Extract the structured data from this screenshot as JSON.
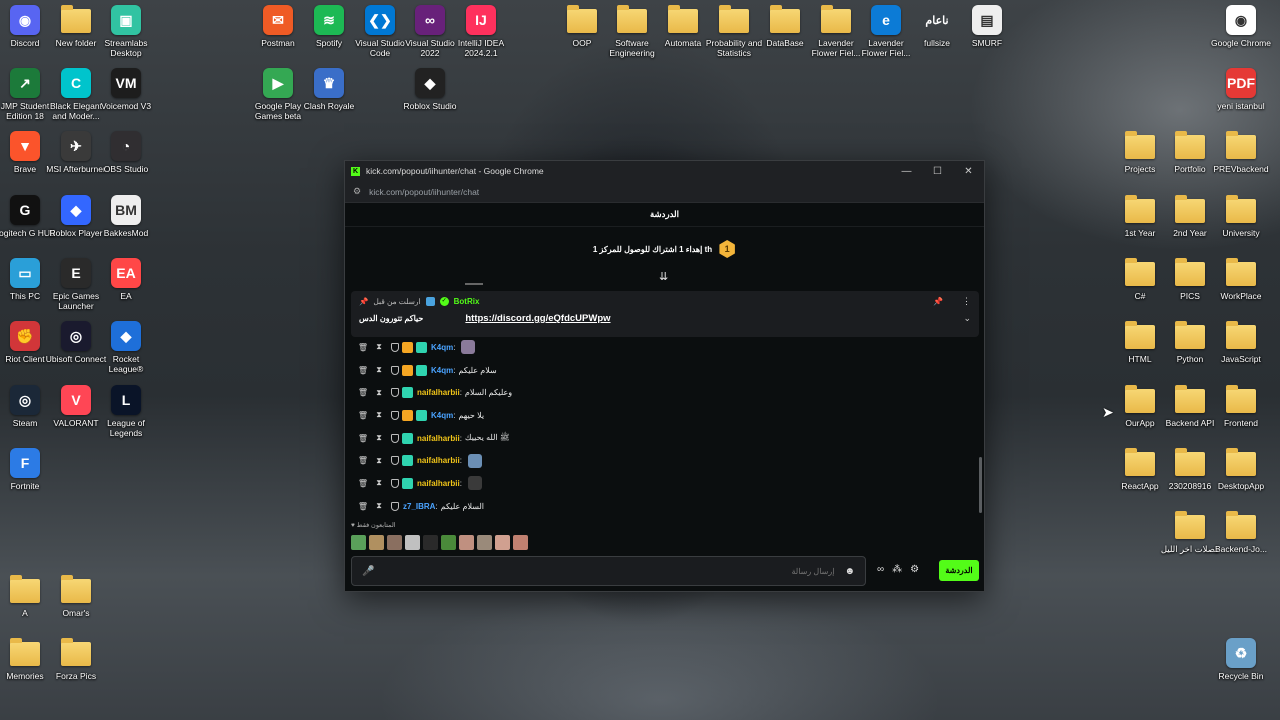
{
  "desktop": {
    "icons_left_col1": [
      {
        "label": "Discord",
        "color": "#5865f2",
        "glyph": "◉"
      },
      {
        "label": "JMP Student Edition 18",
        "color": "#1c7a3a",
        "glyph": "↗"
      },
      {
        "label": "Brave",
        "color": "#fb542b",
        "glyph": "▼"
      },
      {
        "label": "Logitech G HUB",
        "color": "#111111",
        "glyph": "G"
      },
      {
        "label": "This PC",
        "color": "#2a9fd8",
        "glyph": "▭"
      },
      {
        "label": "Riot Client",
        "color": "#d13639",
        "glyph": "✊"
      },
      {
        "label": "Steam",
        "color": "#1b2838",
        "glyph": "◎"
      },
      {
        "label": "Fortnite",
        "color": "#2c7be5",
        "glyph": "F"
      }
    ],
    "icons_left_col2": [
      {
        "label": "New folder",
        "type": "folder"
      },
      {
        "label": "Black Elegant and Moder...",
        "color": "#00c4cc",
        "glyph": "C"
      },
      {
        "label": "MSI Afterburner",
        "color": "#3a3a3a",
        "glyph": "✈"
      },
      {
        "label": "Roblox Player",
        "color": "#3367ff",
        "glyph": "◆"
      },
      {
        "label": "Epic Games Launcher",
        "color": "#2a2a2a",
        "glyph": "E"
      },
      {
        "label": "Ubisoft Connect",
        "color": "#1a1a2e",
        "glyph": "◎"
      },
      {
        "label": "VALORANT",
        "color": "#ff4655",
        "glyph": "V"
      },
      {
        "label": "Omar's",
        "type": "folder"
      }
    ],
    "icons_left_col3": [
      {
        "label": "Streamlabs Desktop",
        "color": "#31c3a2",
        "glyph": "▣"
      },
      {
        "label": "Voicemod V3",
        "color": "#1d1d1d",
        "glyph": "VM"
      },
      {
        "label": "OBS Studio",
        "color": "#302e31",
        "glyph": "◔"
      },
      {
        "label": "BakkesMod",
        "color": "#eeeeee",
        "glyph": "BM"
      },
      {
        "label": "EA",
        "color": "#ff4747",
        "glyph": "EA"
      },
      {
        "label": "Rocket League®",
        "color": "#1e6fd9",
        "glyph": "◆"
      },
      {
        "label": "League of Legends",
        "color": "#0a1428",
        "glyph": "L"
      }
    ],
    "icons_bottom_left": [
      {
        "label": "A",
        "type": "folder"
      },
      {
        "label": "Memories",
        "type": "folder"
      },
      {
        "label": "Forza Pics",
        "type": "folder"
      }
    ],
    "icons_top_mid": [
      {
        "label": "Postman",
        "color": "#ef5b25",
        "glyph": "✉"
      },
      {
        "label": "Spotify",
        "color": "#1db954",
        "glyph": "≋"
      },
      {
        "label": "Visual Studio Code",
        "color": "#0078d4",
        "glyph": "❮❯"
      },
      {
        "label": "Visual Studio 2022",
        "color": "#68217a",
        "glyph": "∞"
      },
      {
        "label": "IntelliJ IDEA 2024.2.1",
        "color": "#fe315d",
        "glyph": "IJ"
      },
      {
        "label": "Google Play Games beta",
        "color": "#34a853",
        "glyph": "▶"
      },
      {
        "label": "Clash Royale",
        "color": "#3a6ec8",
        "glyph": "♛"
      },
      {
        "label": "Roblox Studio",
        "color": "#222222",
        "glyph": "◆"
      }
    ],
    "icons_top_right": [
      {
        "label": "OOP",
        "type": "folder"
      },
      {
        "label": "Software Engineering",
        "type": "folder"
      },
      {
        "label": "Automata",
        "type": "folder"
      },
      {
        "label": "Probability and Statistics",
        "type": "folder"
      },
      {
        "label": "DataBase",
        "type": "folder"
      },
      {
        "label": "Lavender Flower Fiel...",
        "type": "folder"
      },
      {
        "label": "Lavender Flower Fiel...",
        "color": "#0c7bd6",
        "glyph": "e"
      },
      {
        "label": "fullsize",
        "glyph_text": "ناعام"
      },
      {
        "label": "SMURF",
        "color": "#eeeeee",
        "glyph": "▤"
      }
    ],
    "icons_right": [
      {
        "label": "Google Chrome",
        "color": "#ffffff",
        "glyph": "◉"
      },
      {
        "label": "yeni istanbul",
        "color": "#e53935",
        "glyph": "PDF"
      },
      {
        "label": "Projects",
        "type": "folder"
      },
      {
        "label": "Portfolio",
        "type": "folder"
      },
      {
        "label": "PREVbackend",
        "type": "folder"
      },
      {
        "label": "1st Year",
        "type": "folder"
      },
      {
        "label": "2nd Year",
        "type": "folder"
      },
      {
        "label": "University",
        "type": "folder"
      },
      {
        "label": "C#",
        "type": "folder"
      },
      {
        "label": "PICS",
        "type": "folder"
      },
      {
        "label": "WorkPlace",
        "type": "folder"
      },
      {
        "label": "HTML",
        "type": "folder"
      },
      {
        "label": "Python",
        "type": "folder"
      },
      {
        "label": "JavaScript",
        "type": "folder"
      },
      {
        "label": "OurApp",
        "type": "folder"
      },
      {
        "label": "Backend API",
        "type": "folder"
      },
      {
        "label": "Frontend",
        "type": "folder"
      },
      {
        "label": "ReactApp",
        "type": "folder"
      },
      {
        "label": "230208916",
        "type": "folder"
      },
      {
        "label": "DesktopApp",
        "type": "folder"
      },
      {
        "label": "فصلات اخر الليل",
        "type": "folder"
      },
      {
        "label": "Backend-Jo...",
        "type": "folder"
      },
      {
        "label": "Recycle Bin",
        "color": "#6aa0c8",
        "glyph": "♻"
      }
    ]
  },
  "window": {
    "title": "kick.com/popout/iihunter/chat - Google Chrome",
    "favicon": "K",
    "url": "kick.com/popout/iihunter/chat",
    "controls": {
      "minimize": "—",
      "maximize": "☐",
      "close": "✕"
    }
  },
  "chat": {
    "header": "الدردشة",
    "goal": {
      "number": "1",
      "text": "إهداء 1 اشتراك للوصول للمركز 1 th"
    },
    "pinned": {
      "pin_label": "ارسلت من قبل",
      "author": "BotRix",
      "arabic_text": "حياكم تتورون الدس",
      "link": "https://discord.gg/eQfdcUPWpw"
    },
    "messages": [
      {
        "user": "K4qm",
        "user_color": "#4aa3ff",
        "badges": [
          "shield",
          "crown",
          "sub"
        ],
        "text": "",
        "emote": "#8a7a9a"
      },
      {
        "user": "K4qm",
        "user_color": "#4aa3ff",
        "badges": [
          "shield",
          "crown",
          "sub"
        ],
        "text": "سلام عليكم",
        "emote": ""
      },
      {
        "user": "naifalharbii",
        "user_color": "#f0c419",
        "badges": [
          "shield",
          "sub"
        ],
        "text": "وعليكم السلام",
        "emote": ""
      },
      {
        "user": "K4qm",
        "user_color": "#4aa3ff",
        "badges": [
          "shield",
          "crown",
          "sub"
        ],
        "text": "يلا حيهم",
        "emote": ""
      },
      {
        "user": "naifalharbii",
        "user_color": "#f0c419",
        "badges": [
          "shield",
          "sub"
        ],
        "text": "ﷺ الله يحييك",
        "emote": ""
      },
      {
        "user": "naifalharbii",
        "user_color": "#f0c419",
        "badges": [
          "shield",
          "sub"
        ],
        "text": "",
        "emote": "#6b8fb5"
      },
      {
        "user": "naifalharbii",
        "user_color": "#f0c419",
        "badges": [
          "shield",
          "sub"
        ],
        "text": "",
        "emote": "#3a3a3a"
      },
      {
        "user": "z7_IBRA",
        "user_color": "#4aa3ff",
        "badges": [
          "shield"
        ],
        "text": "السلام عليكم",
        "emote": ""
      }
    ],
    "subs_only_label": "المتابعون فقط",
    "emote_row": [
      "#5aa05a",
      "#b09060",
      "#8a6f60",
      "#c0c0c0",
      "#2a2a2a",
      "#4a8a3a",
      "#c09080",
      "#9a8a7a",
      "#d0a090",
      "#c08070"
    ],
    "input_placeholder": "إرسال رسالة",
    "send_label": "الدردشة"
  }
}
